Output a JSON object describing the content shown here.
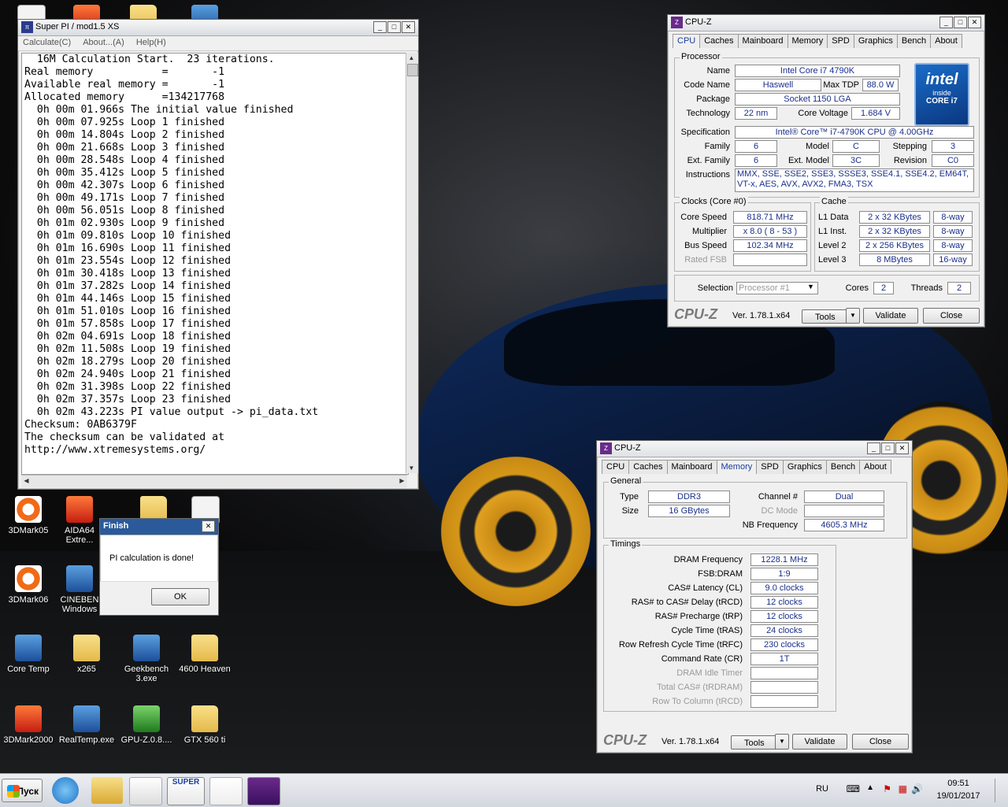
{
  "desktop": {
    "icons": [
      {
        "label": "3DMark05"
      },
      {
        "label": "AIDA64 Extre..."
      },
      {
        "label": "3DMark06"
      },
      {
        "label": "CINEBEN Windows"
      },
      {
        "label": "Core Temp"
      },
      {
        "label": "x265"
      },
      {
        "label": "Geekbench 3.exe"
      },
      {
        "label": "4600 Heaven"
      },
      {
        "label": "3DMark2000"
      },
      {
        "label": "RealTemp.exe"
      },
      {
        "label": "GPU-Z.0.8...."
      },
      {
        "label": "GTX 560 ti"
      }
    ]
  },
  "superpi": {
    "title": "Super PI / mod1.5 XS",
    "menu": [
      "Calculate(C)",
      "About...(A)",
      "Help(H)"
    ],
    "output": [
      "  16M Calculation Start.  23 iterations.",
      "Real memory           =       -1",
      "Available real memory =       -1",
      "Allocated memory      =134217768",
      "  0h 00m 01.966s The initial value finished",
      "  0h 00m 07.925s Loop 1 finished",
      "  0h 00m 14.804s Loop 2 finished",
      "  0h 00m 21.668s Loop 3 finished",
      "  0h 00m 28.548s Loop 4 finished",
      "  0h 00m 35.412s Loop 5 finished",
      "  0h 00m 42.307s Loop 6 finished",
      "  0h 00m 49.171s Loop 7 finished",
      "  0h 00m 56.051s Loop 8 finished",
      "  0h 01m 02.930s Loop 9 finished",
      "  0h 01m 09.810s Loop 10 finished",
      "  0h 01m 16.690s Loop 11 finished",
      "  0h 01m 23.554s Loop 12 finished",
      "  0h 01m 30.418s Loop 13 finished",
      "  0h 01m 37.282s Loop 14 finished",
      "  0h 01m 44.146s Loop 15 finished",
      "  0h 01m 51.010s Loop 16 finished",
      "  0h 01m 57.858s Loop 17 finished",
      "  0h 02m 04.691s Loop 18 finished",
      "  0h 02m 11.508s Loop 19 finished",
      "  0h 02m 18.279s Loop 20 finished",
      "  0h 02m 24.940s Loop 21 finished",
      "  0h 02m 31.398s Loop 22 finished",
      "  0h 02m 37.357s Loop 23 finished",
      "  0h 02m 43.223s PI value output -> pi_data.txt",
      "",
      "Checksum: 0AB6379F",
      "The checksum can be validated at",
      "http://www.xtremesystems.org/"
    ]
  },
  "finish": {
    "title": "Finish",
    "message": "PI calculation is done!",
    "ok": "OK"
  },
  "cpuz_cpu": {
    "title": "CPU-Z",
    "tabs": [
      "CPU",
      "Caches",
      "Mainboard",
      "Memory",
      "SPD",
      "Graphics",
      "Bench",
      "About"
    ],
    "processor_group": "Processor",
    "name_label": "Name",
    "name": "Intel Core i7 4790K",
    "codename_label": "Code Name",
    "codename": "Haswell",
    "maxtdp_label": "Max TDP",
    "maxtdp": "88.0 W",
    "package_label": "Package",
    "package": "Socket 1150 LGA",
    "technology_label": "Technology",
    "technology": "22 nm",
    "corevoltage_label": "Core Voltage",
    "corevoltage": "1.684 V",
    "spec_label": "Specification",
    "spec": "Intel® Core™ i7-4790K CPU @ 4.00GHz",
    "family_label": "Family",
    "family": "6",
    "model_label": "Model",
    "model": "C",
    "stepping_label": "Stepping",
    "stepping": "3",
    "extfamily_label": "Ext. Family",
    "extfamily": "6",
    "extmodel_label": "Ext. Model",
    "extmodel": "3C",
    "revision_label": "Revision",
    "revision": "C0",
    "instructions_label": "Instructions",
    "instructions": "MMX, SSE, SSE2, SSE3, SSSE3, SSE4.1, SSE4.2, EM64T, VT-x, AES, AVX, AVX2, FMA3, TSX",
    "clocks_group": "Clocks (Core #0)",
    "corespeed_label": "Core Speed",
    "corespeed": "818.71 MHz",
    "multiplier_label": "Multiplier",
    "multiplier": "x 8.0 ( 8 - 53 )",
    "busspeed_label": "Bus Speed",
    "busspeed": "102.34 MHz",
    "ratedfsb_label": "Rated FSB",
    "ratedfsb": "",
    "cache_group": "Cache",
    "l1data_label": "L1 Data",
    "l1data": "2 x 32 KBytes",
    "l1data_way": "8-way",
    "l1inst_label": "L1 Inst.",
    "l1inst": "2 x 32 KBytes",
    "l1inst_way": "8-way",
    "l2_label": "Level 2",
    "l2": "2 x 256 KBytes",
    "l2_way": "8-way",
    "l3_label": "Level 3",
    "l3": "8 MBytes",
    "l3_way": "16-way",
    "selection_label": "Selection",
    "selection": "Processor #1",
    "cores_label": "Cores",
    "cores": "2",
    "threads_label": "Threads",
    "threads": "2",
    "logo": "CPU-Z",
    "version": "Ver. 1.78.1.x64",
    "tools": "Tools",
    "validate": "Validate",
    "close": "Close",
    "intel_badge": {
      "brand": "intel",
      "inside": "inside",
      "series": "CORE i7"
    }
  },
  "cpuz_mem": {
    "title": "CPU-Z",
    "tabs": [
      "CPU",
      "Caches",
      "Mainboard",
      "Memory",
      "SPD",
      "Graphics",
      "Bench",
      "About"
    ],
    "general_group": "General",
    "type_label": "Type",
    "type": "DDR3",
    "size_label": "Size",
    "size": "16 GBytes",
    "channel_label": "Channel #",
    "channel": "Dual",
    "dcmode_label": "DC Mode",
    "dcmode": "",
    "nbfreq_label": "NB Frequency",
    "nbfreq": "4605.3 MHz",
    "timings_group": "Timings",
    "timings": [
      {
        "label": "DRAM Frequency",
        "value": "1228.1 MHz",
        "dim": false
      },
      {
        "label": "FSB:DRAM",
        "value": "1:9",
        "dim": false
      },
      {
        "label": "CAS# Latency (CL)",
        "value": "9.0 clocks",
        "dim": false
      },
      {
        "label": "RAS# to CAS# Delay (tRCD)",
        "value": "12 clocks",
        "dim": false
      },
      {
        "label": "RAS# Precharge (tRP)",
        "value": "12 clocks",
        "dim": false
      },
      {
        "label": "Cycle Time (tRAS)",
        "value": "24 clocks",
        "dim": false
      },
      {
        "label": "Row Refresh Cycle Time (tRFC)",
        "value": "230 clocks",
        "dim": false
      },
      {
        "label": "Command Rate (CR)",
        "value": "1T",
        "dim": false
      },
      {
        "label": "DRAM Idle Timer",
        "value": "",
        "dim": true
      },
      {
        "label": "Total CAS# (tRDRAM)",
        "value": "",
        "dim": true
      },
      {
        "label": "Row To Column (tRCD)",
        "value": "",
        "dim": true
      }
    ],
    "logo": "CPU-Z",
    "version": "Ver. 1.78.1.x64",
    "tools": "Tools",
    "validate": "Validate",
    "close": "Close"
  },
  "taskbar": {
    "start": "Пуск",
    "lang": "RU",
    "time": "09:51",
    "date": "19/01/2017",
    "superpi_badge": "SUPER"
  }
}
